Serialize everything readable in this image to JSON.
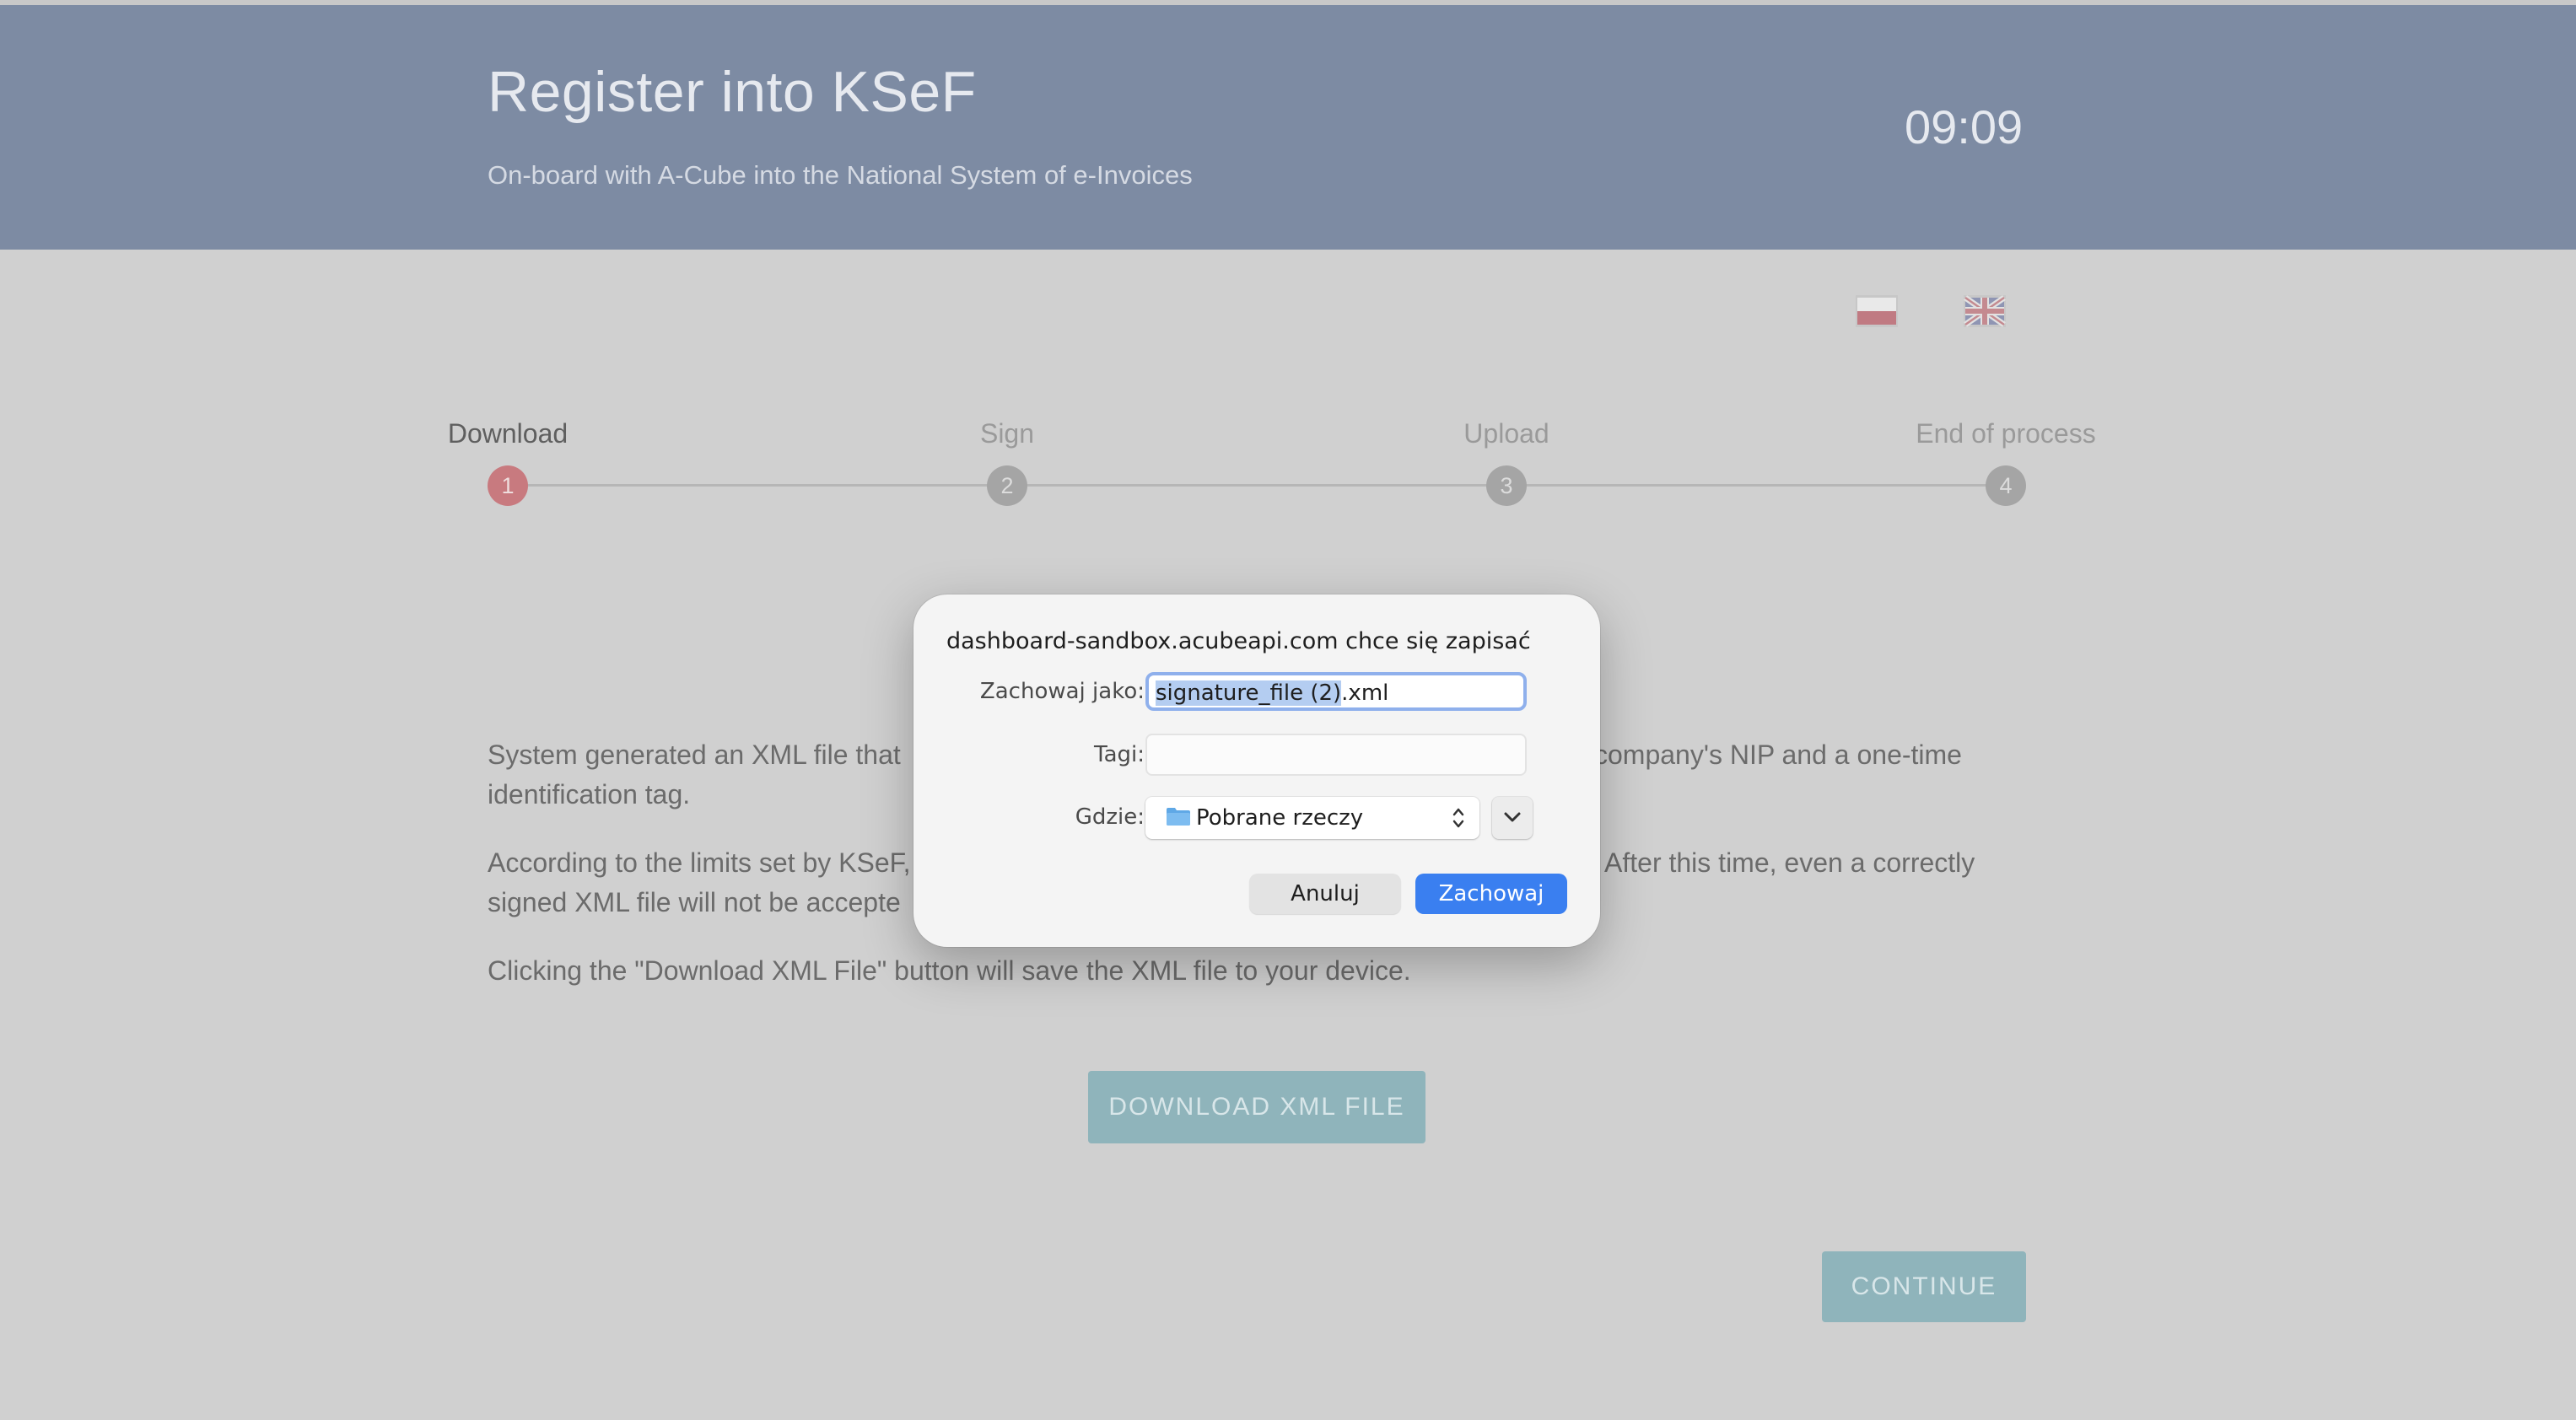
{
  "header": {
    "title": "Register into KSeF",
    "subtitle": "On-board with A-Cube into the National System of e-Invoices",
    "clock": "09:09"
  },
  "languages": [
    {
      "name": "flag-pl-icon"
    },
    {
      "name": "flag-uk-icon"
    }
  ],
  "stepper": {
    "steps": [
      {
        "label": "Download",
        "number": "1",
        "active": true
      },
      {
        "label": "Sign",
        "number": "2",
        "active": false
      },
      {
        "label": "Upload",
        "number": "3",
        "active": false
      },
      {
        "label": "End of process",
        "number": "4",
        "active": false
      }
    ]
  },
  "body": {
    "p1_left": "System generated an XML file that",
    "p1_right": "company's NIP and a one-time",
    "p1_line2": "identification tag.",
    "p2_left": "According to the limits set by KSeF,",
    "p2_right": "s. After this time, even a correctly",
    "p2_line2": "signed XML file will not be accepte",
    "p3": "Clicking the \"Download XML File\" button will save the XML file to your device.",
    "download_button": "DOWNLOAD XML FILE",
    "continue_button": "CONTINUE"
  },
  "dialog": {
    "heading": "dashboard-sandbox.acubeapi.com chce się zapisać",
    "save_as_label": "Zachowaj jako:",
    "filename_selected": "signature_file (2)",
    "filename_ext": ".xml",
    "tags_label": "Tagi:",
    "tags_value": "",
    "where_label": "Gdzie:",
    "where_value": "Pobrane rzeczy",
    "cancel_label": "Anuluj",
    "save_label": "Zachowaj",
    "accent_color": "#3a7ff0"
  }
}
